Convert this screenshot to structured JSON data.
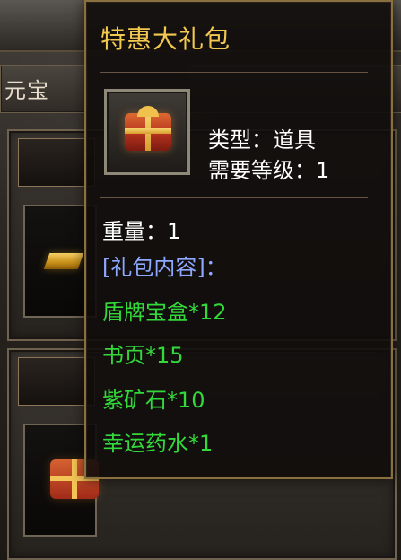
{
  "tooltip": {
    "title": "特惠大礼包",
    "type_text": "类型：道具",
    "level_text": "需要等级：1",
    "weight_text": "重量：1",
    "contents_header": "[礼包内容]：",
    "contents": [
      "盾牌宝盒*12",
      "书页*15",
      "紫矿石*10",
      "幸运药水*1"
    ]
  },
  "background": {
    "left_tab_label": "元宝"
  },
  "icons": {
    "gift": "gift-box-icon",
    "gold": "gold-bar-icon"
  },
  "colors": {
    "title": "#f2c84f",
    "white_text": "#ffffff",
    "contents_header": "#8ea7ff",
    "content_items": "#33d93a",
    "tooltip_border": "#8a6f3f"
  }
}
